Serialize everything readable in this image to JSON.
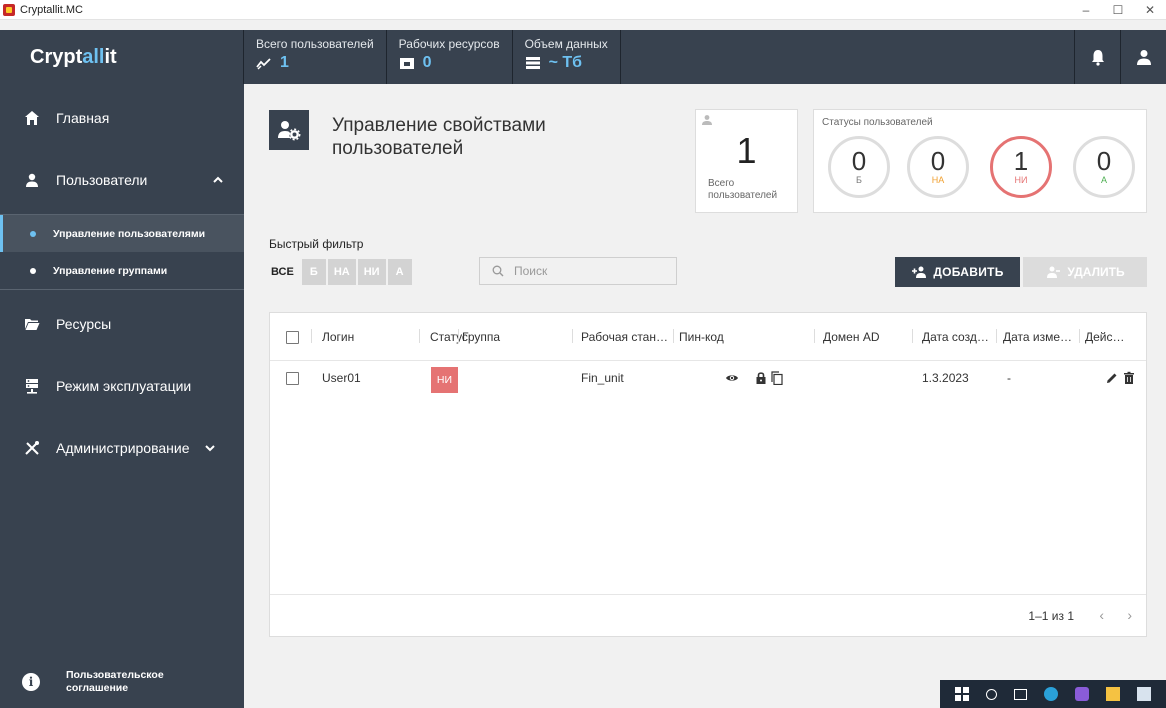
{
  "window": {
    "title": "Cryptallit.MC",
    "minimize": "–",
    "maximize": "☐",
    "close": "✕"
  },
  "header": {
    "brand_prefix": "Crypt",
    "brand_accent": "all",
    "brand_suffix": "it",
    "stats": [
      {
        "label": "Всего пользователей",
        "value": "1",
        "icon": "trend-icon"
      },
      {
        "label": "Рабочих ресурсов",
        "value": "0",
        "icon": "folder-icon"
      },
      {
        "label": "Объем данных",
        "value": "~ Тб",
        "icon": "storage-icon"
      }
    ],
    "notifications_icon": "bell-icon",
    "profile_icon": "user-icon"
  },
  "sidebar": {
    "items": [
      {
        "label": "Главная",
        "icon": "home-icon"
      },
      {
        "label": "Пользователи",
        "icon": "user-icon"
      },
      {
        "label": "Ресурсы",
        "icon": "folder-icon"
      },
      {
        "label": "Режим эксплуатации",
        "icon": "server-icon"
      },
      {
        "label": "Администрирование",
        "icon": "tools-icon"
      }
    ],
    "sub_items": [
      {
        "label": "Управление пользователями",
        "active": true
      },
      {
        "label": "Управление группами",
        "active": false
      }
    ],
    "agreement_line1": "Пользовательское",
    "agreement_line2": "соглашение",
    "agreement_icon_glyph": "i"
  },
  "main": {
    "title_line1": "Управление свойствами",
    "title_line2": "пользователей",
    "total": {
      "value": "1",
      "caption_line1": "Всего",
      "caption_line2": "пользователей"
    },
    "statuses": {
      "caption": "Статусы пользователей",
      "items": [
        {
          "value": "0",
          "label": "Б",
          "color": "#777777"
        },
        {
          "value": "0",
          "label": "НА",
          "color": "#f0a030"
        },
        {
          "value": "1",
          "label": "НИ",
          "color": "#e57373"
        },
        {
          "value": "0",
          "label": "А",
          "color": "#4caf50"
        }
      ]
    },
    "quick_filter": {
      "label": "Быстрый фильтр",
      "chips": [
        "ВСЕ",
        "Б",
        "НА",
        "НИ",
        "А"
      ]
    },
    "search": {
      "placeholder": "Поиск"
    },
    "add_label": "ДОБАВИТЬ",
    "delete_label": "УДАЛИТЬ",
    "table": {
      "columns": [
        "Логин",
        "Статус",
        "Группа",
        "Рабочая стан…",
        "Пин-код",
        "Домен AD",
        "Дата созд…",
        "Дата изме…",
        "Дейс…"
      ],
      "rows": [
        {
          "login": "User01",
          "status": "НИ",
          "group": "",
          "workstation": "Fin_unit",
          "pin": "",
          "domain": "",
          "created": "1.3.2023",
          "modified": "-"
        }
      ],
      "pagination": "1–1 из 1",
      "prev": "‹",
      "next": "›"
    }
  },
  "colors": {
    "sidebar": "#38424f",
    "accent": "#6ec1f1",
    "danger": "#e57373",
    "chip_inactive": "#d3d3d3"
  }
}
